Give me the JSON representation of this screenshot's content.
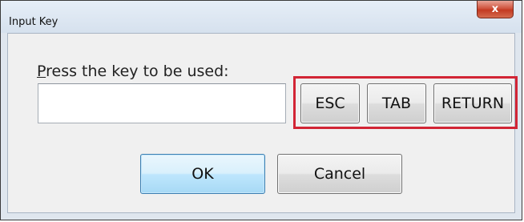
{
  "window": {
    "title": "Input Key",
    "close_glyph": "x"
  },
  "dialog": {
    "prompt_mnemonic": "P",
    "prompt_rest": "ress the key to be used:",
    "key_input_value": "",
    "key_buttons": {
      "esc_label": "ESC",
      "tab_label": "TAB",
      "return_label": "RETURN"
    },
    "ok_label": "OK",
    "cancel_label": "Cancel"
  },
  "colors": {
    "highlight_border": "#d22535",
    "close_button": "#c33a22",
    "default_button_border": "#3c7fb1"
  },
  "icons": {
    "close": "close-icon"
  }
}
